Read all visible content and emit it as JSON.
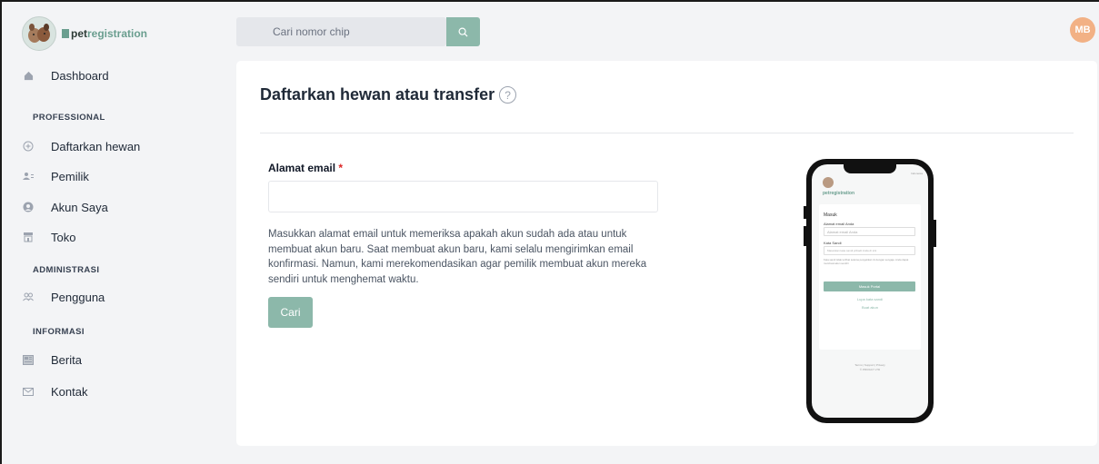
{
  "brand": {
    "name_prefix": "pet",
    "name_suffix": "registration",
    "suffix_mark": "an"
  },
  "sidebar": {
    "dashboard": "Dashboard",
    "sections": [
      {
        "title": "PROFESSIONAL",
        "items": [
          "Daftarkan hewan",
          "Pemilik",
          "Akun Saya",
          "Toko"
        ]
      },
      {
        "title": "ADMINISTRASI",
        "items": [
          "Pengguna"
        ]
      },
      {
        "title": "INFORMASI",
        "items": [
          "Berita",
          "Kontak"
        ]
      }
    ]
  },
  "header": {
    "search_placeholder": "Cari nomor chip",
    "avatar_initials": "MB"
  },
  "main": {
    "title": "Daftarkan hewan atau transfer",
    "help_glyph": "?",
    "email_label": "Alamat email",
    "required_mark": "*",
    "email_value": "",
    "help_text": "Masukkan alamat email untuk memeriksa apakah akun sudah ada atau untuk membuat akun baru. Saat membuat akun baru, kami selalu mengirimkan email konfirmasi. Namun, kami merekomendasikan agar pemilik membuat akun mereka sendiri untuk menghemat waktu.",
    "search_button": "Cari"
  },
  "phone": {
    "lang": "Indonesia",
    "brand": "petregistration",
    "heading": "Masuk",
    "email_label": "Alamat email Anda",
    "email_placeholder": "Alamat email Anda",
    "password_label": "Kata Sandi",
    "password_placeholder": "Masukkan kata sandi pribadi Anda di sini",
    "note": "Kata sandi tidak terlihat selama pengetikan ini dengan sengaja. Anda dapat membuat akun sendiri",
    "login_button": "Masuk Portal",
    "forgot": "Lupa kata sandi",
    "create": "Buat akun",
    "footer": "Terms | Support | Privacy",
    "copyright": "© PRIVACY LTD"
  },
  "colors": {
    "accent": "#8cb8aa",
    "avatar": "#f2b185",
    "required": "#dc2626"
  }
}
